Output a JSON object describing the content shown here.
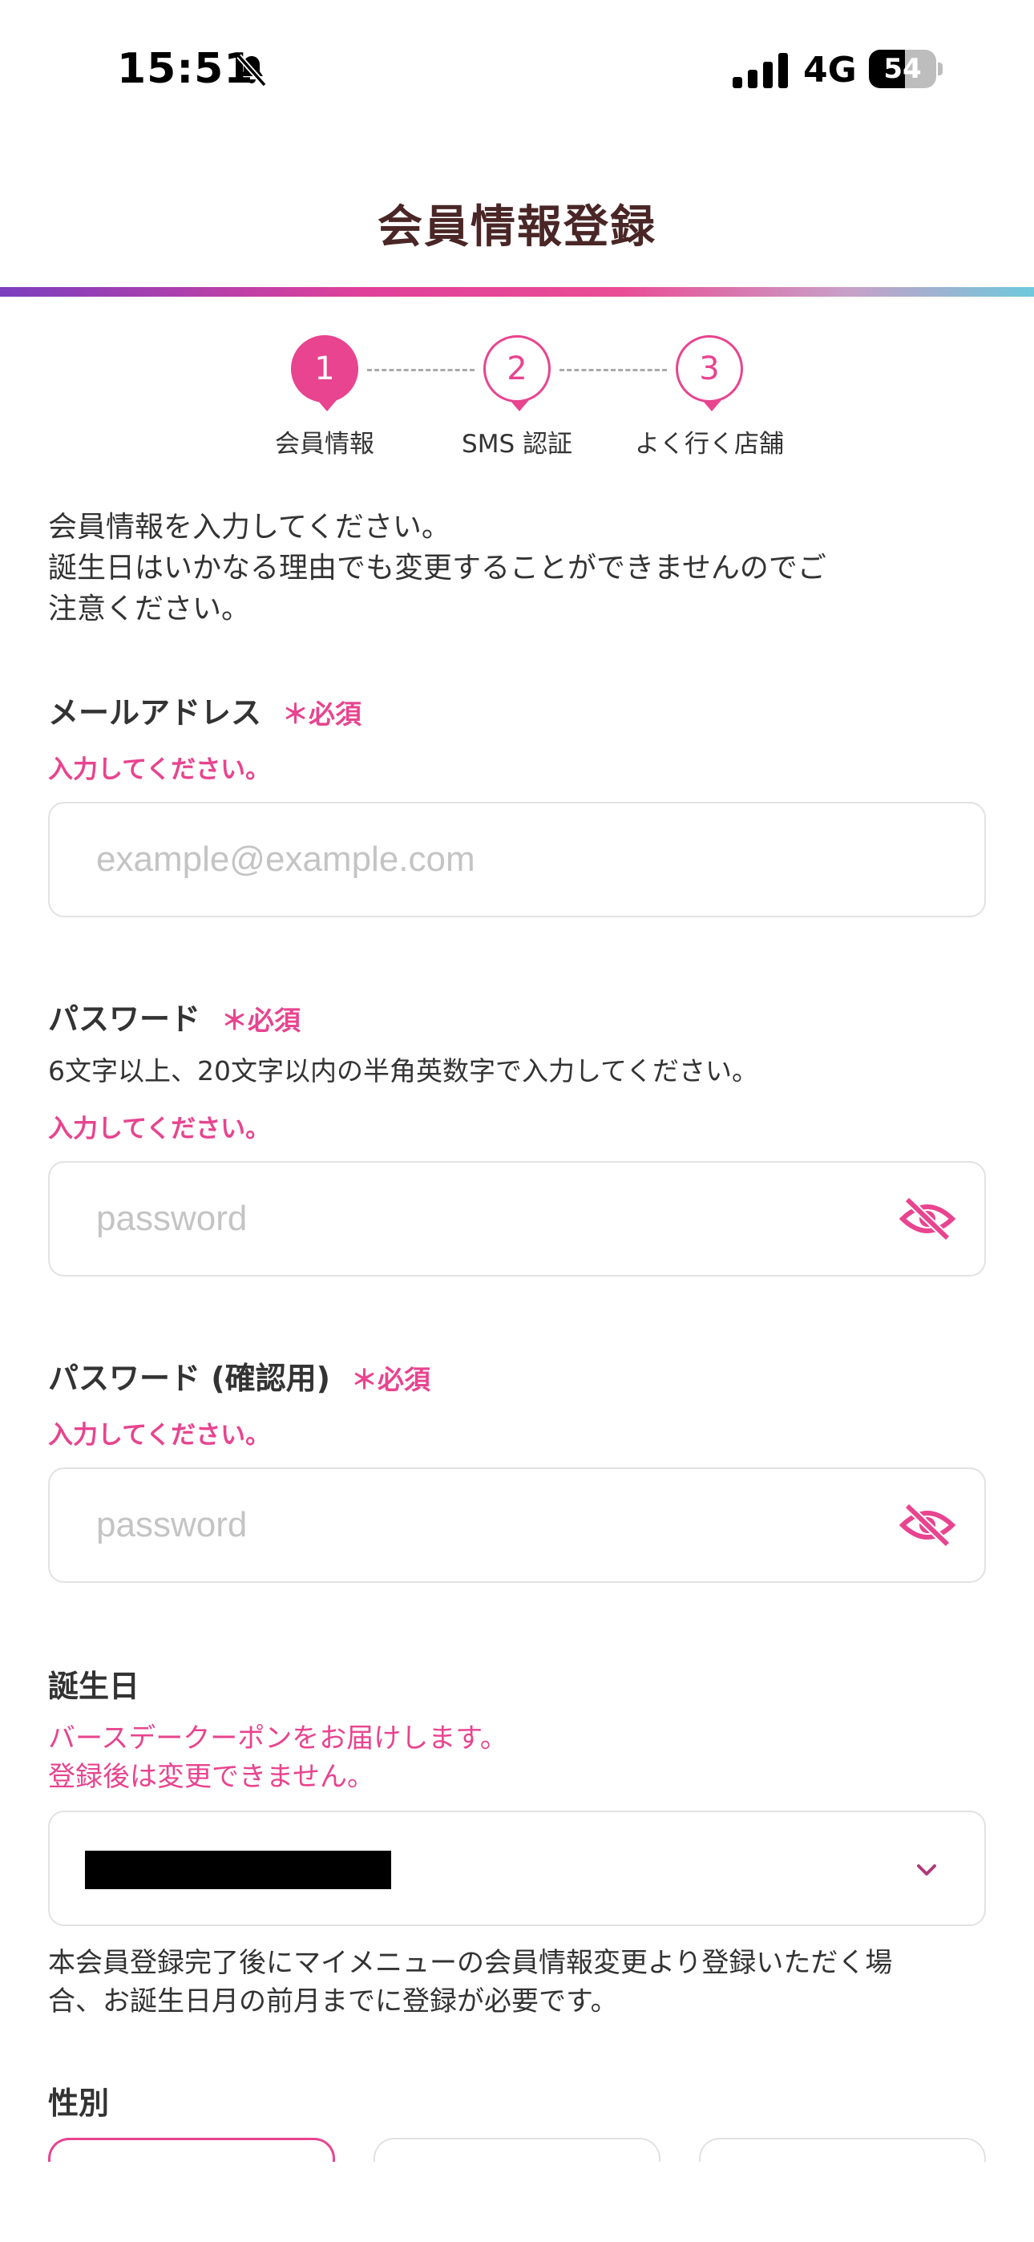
{
  "status_bar": {
    "time": "15:51",
    "network": "4G",
    "battery": "54",
    "battery_level": 0.54
  },
  "header": {
    "title": "会員情報登録"
  },
  "stepper": {
    "steps": [
      {
        "number": "1",
        "label": "会員情報"
      },
      {
        "number": "2",
        "label": "SMS 認証"
      },
      {
        "number": "3",
        "label": "よく行く店舗"
      }
    ],
    "active_step": 1
  },
  "intro": {
    "line1": "会員情報を入力してください。",
    "line2": "誕生日はいかなる理由でも変更することができませんのでご",
    "line3": "注意ください。"
  },
  "email": {
    "label": "メールアドレス",
    "required": "＊必須",
    "error": "入力してください。",
    "placeholder": "example@example.com",
    "value": ""
  },
  "password": {
    "label": "パスワード",
    "required": "＊必須",
    "note": "6文字以上、20文字以内の半角英数字で入力してください。",
    "error": "入力してください。",
    "placeholder": "password"
  },
  "password_confirm": {
    "label": "パスワード (確認用)",
    "required": "＊必須",
    "error": "入力してください。",
    "placeholder": "password"
  },
  "birthday": {
    "label": "誕生日",
    "note1": "バースデークーポンをお届けします。",
    "note2": "登録後は変更できません。",
    "footnote1": "本会員登録完了後にマイメニューの会員情報変更より登録いただく場",
    "footnote2": "合、お誕生日月の前月までに登録が必要です。"
  },
  "gender": {
    "label": "性別"
  },
  "colors": {
    "accent": "#e8448f",
    "title": "#4a2626",
    "border": "#e2e2e2"
  },
  "icons": [
    "bell-slash-icon",
    "signal-icon",
    "battery-icon",
    "eye-slash-icon",
    "chevron-down-icon"
  ]
}
